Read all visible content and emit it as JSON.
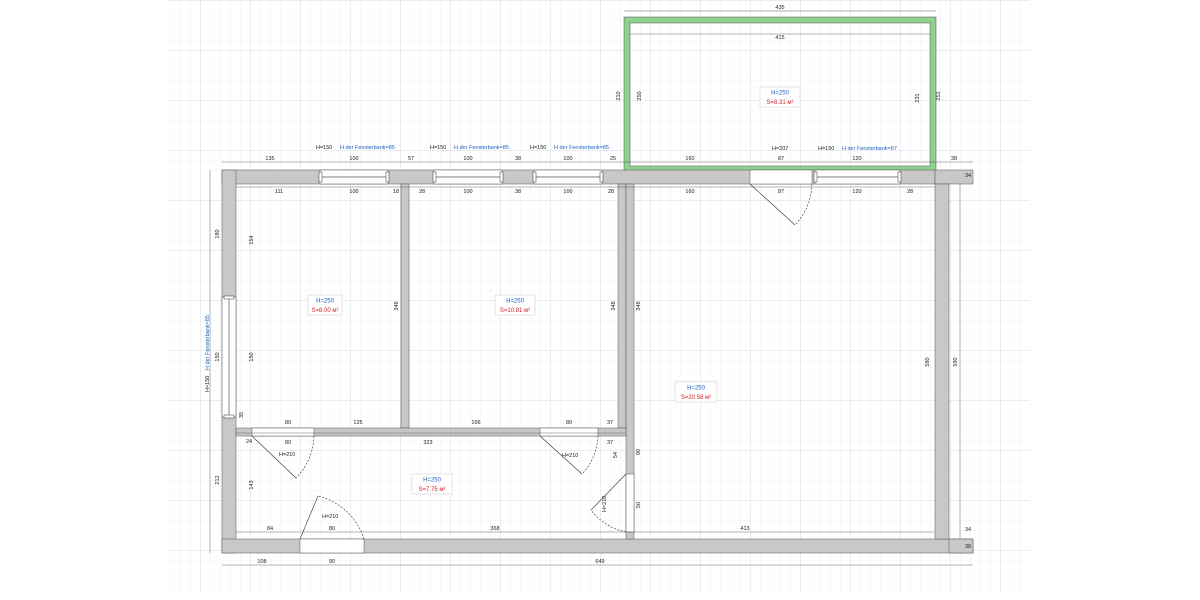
{
  "colors": {
    "wall": "#c8c8c8",
    "wall_stroke": "#555555",
    "balcony": "#8fd18f",
    "grid": "#e3e7ee",
    "grid_major": "#d3d9e3",
    "height_label": "#1f5fbf",
    "area_label": "#d0202a"
  },
  "rooms": [
    {
      "id": "room-1",
      "height": "H=250",
      "area": "S=8.00 м²"
    },
    {
      "id": "room-2",
      "height": "H=250",
      "area": "S=10.81 м²"
    },
    {
      "id": "room-3",
      "height": "H=250",
      "area": "S=20.58 м²"
    },
    {
      "id": "hall",
      "height": "H=250",
      "area": "S=7.75 м²"
    },
    {
      "id": "balcony",
      "height": "H=250",
      "area": "S=8.31 м²"
    }
  ],
  "windows": [
    {
      "height": "H=150",
      "sill": "H der Fensterbank=85"
    },
    {
      "height": "H=150",
      "sill": "H der Fensterbank=85"
    },
    {
      "height": "H=150",
      "sill": "H der Fensterbank=85"
    },
    {
      "height": "H=150",
      "sill": "H der Fensterbank=87"
    },
    {
      "height": "H=150",
      "sill": "H der Fensterbank=85"
    }
  ],
  "door_labels": [
    "H=207",
    "H=210",
    "H=210",
    "H=210",
    "H=210"
  ],
  "dimensions": {
    "top_outer": [
      "135",
      "100",
      "57",
      "100",
      "38",
      "100",
      "25",
      "160",
      "87",
      "120",
      "38"
    ],
    "top_inner": [
      "111",
      "100",
      "18",
      "28",
      "100",
      "38",
      "100",
      "28",
      "160",
      "87",
      "120",
      "28"
    ],
    "balcony": [
      "435",
      "415",
      "210",
      "250",
      "231",
      "251"
    ],
    "left": [
      "180",
      "154",
      "150",
      "150",
      "35",
      "24",
      "212",
      "143"
    ],
    "right": [
      "34",
      "580",
      "590",
      "34",
      "38"
    ],
    "interior": [
      "348",
      "348",
      "348",
      "80",
      "125",
      "80",
      "323",
      "166",
      "80",
      "37",
      "37",
      "54",
      "90",
      "50",
      "84",
      "80",
      "368",
      "413"
    ],
    "bottom": [
      "108",
      "90",
      "649"
    ]
  }
}
